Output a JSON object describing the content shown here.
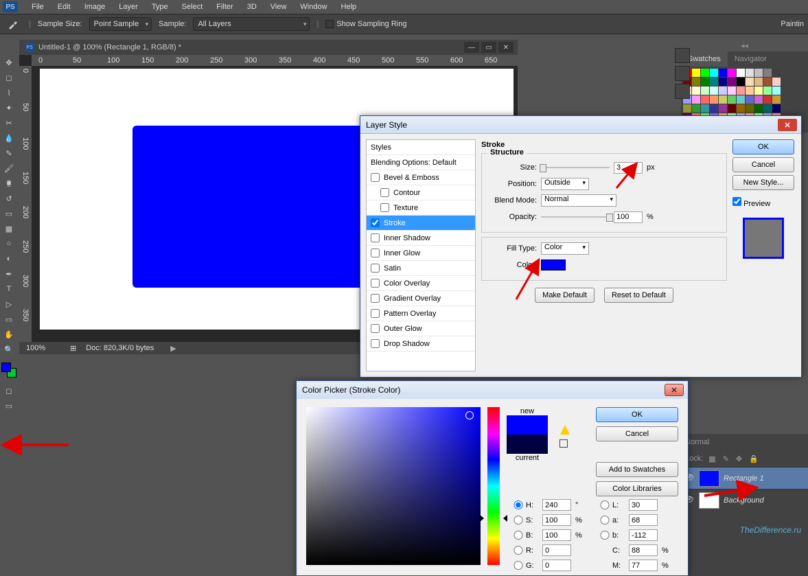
{
  "app_logo": "PS",
  "menubar": [
    "File",
    "Edit",
    "Image",
    "Layer",
    "Type",
    "Select",
    "Filter",
    "3D",
    "View",
    "Window",
    "Help"
  ],
  "optionsbar": {
    "sample_size_label": "Sample Size:",
    "sample_size_value": "Point Sample",
    "sample_label": "Sample:",
    "sample_value": "All Layers",
    "show_sampling_ring": "Show Sampling Ring",
    "right_truncated": "Paintin"
  },
  "document": {
    "title": "Untitled-1 @ 100% (Rectangle 1, RGB/8) *",
    "zoom": "100%",
    "doc_info": "Doc: 820,3K/0 bytes",
    "ruler_h": [
      "0",
      "50",
      "100",
      "150",
      "200",
      "250",
      "300",
      "350",
      "400",
      "450",
      "500",
      "550",
      "600",
      "650"
    ],
    "ruler_v": [
      "0",
      "50",
      "100",
      "150",
      "200",
      "250",
      "300",
      "350"
    ]
  },
  "fg_color": "#0000ff",
  "bg_color": "#00cc33",
  "right_panels": {
    "swatches_tab": "Swatches",
    "navigator_tab": "Navigator"
  },
  "layers": {
    "normal": "Normal",
    "lock": "Lock:",
    "items": [
      {
        "name": "Rectangle 1",
        "blue": true
      },
      {
        "name": "Background",
        "blue": false
      }
    ]
  },
  "watermark": "TheDifference.ru",
  "layerstyle": {
    "title": "Layer Style",
    "sidebar": {
      "styles": "Styles",
      "blending": "Blending Options: Default",
      "items": [
        {
          "label": "Bevel & Emboss",
          "checked": false,
          "indent": 0
        },
        {
          "label": "Contour",
          "checked": false,
          "indent": 1
        },
        {
          "label": "Texture",
          "checked": false,
          "indent": 1
        },
        {
          "label": "Stroke",
          "checked": true,
          "indent": 0,
          "selected": true
        },
        {
          "label": "Inner Shadow",
          "checked": false,
          "indent": 0
        },
        {
          "label": "Inner Glow",
          "checked": false,
          "indent": 0
        },
        {
          "label": "Satin",
          "checked": false,
          "indent": 0
        },
        {
          "label": "Color Overlay",
          "checked": false,
          "indent": 0
        },
        {
          "label": "Gradient Overlay",
          "checked": false,
          "indent": 0
        },
        {
          "label": "Pattern Overlay",
          "checked": false,
          "indent": 0
        },
        {
          "label": "Outer Glow",
          "checked": false,
          "indent": 0
        },
        {
          "label": "Drop Shadow",
          "checked": false,
          "indent": 0
        }
      ]
    },
    "stroke": {
      "heading": "Stroke",
      "structure": "Structure",
      "size_label": "Size:",
      "size_value": "3",
      "size_unit": "px",
      "position_label": "Position:",
      "position_value": "Outside",
      "blend_label": "Blend Mode:",
      "blend_value": "Normal",
      "opacity_label": "Opacity:",
      "opacity_value": "100",
      "opacity_unit": "%",
      "filltype_label": "Fill Type:",
      "filltype_value": "Color",
      "color_label": "Color:",
      "color_value": "#0000ff",
      "make_default": "Make Default",
      "reset_default": "Reset to Default"
    },
    "buttons": {
      "ok": "OK",
      "cancel": "Cancel",
      "newstyle": "New Style...",
      "preview": "Preview"
    }
  },
  "colorpicker": {
    "title": "Color Picker (Stroke Color)",
    "new": "new",
    "current": "current",
    "new_color": "#0000ff",
    "current_color": "#000040",
    "ok": "OK",
    "cancel": "Cancel",
    "add_swatches": "Add to Swatches",
    "color_libraries": "Color Libraries",
    "fields": {
      "H": {
        "label": "H:",
        "value": "240",
        "unit": "°"
      },
      "S": {
        "label": "S:",
        "value": "100",
        "unit": "%"
      },
      "B": {
        "label": "B:",
        "value": "100",
        "unit": "%"
      },
      "R": {
        "label": "R:",
        "value": "0",
        "unit": ""
      },
      "G": {
        "label": "G:",
        "value": "0",
        "unit": ""
      },
      "L": {
        "label": "L:",
        "value": "30",
        "unit": ""
      },
      "a": {
        "label": "a:",
        "value": "68",
        "unit": ""
      },
      "b": {
        "label": "b:",
        "value": "-112",
        "unit": ""
      },
      "C": {
        "label": "C:",
        "value": "88",
        "unit": "%"
      },
      "M": {
        "label": "M:",
        "value": "77",
        "unit": "%"
      }
    }
  }
}
